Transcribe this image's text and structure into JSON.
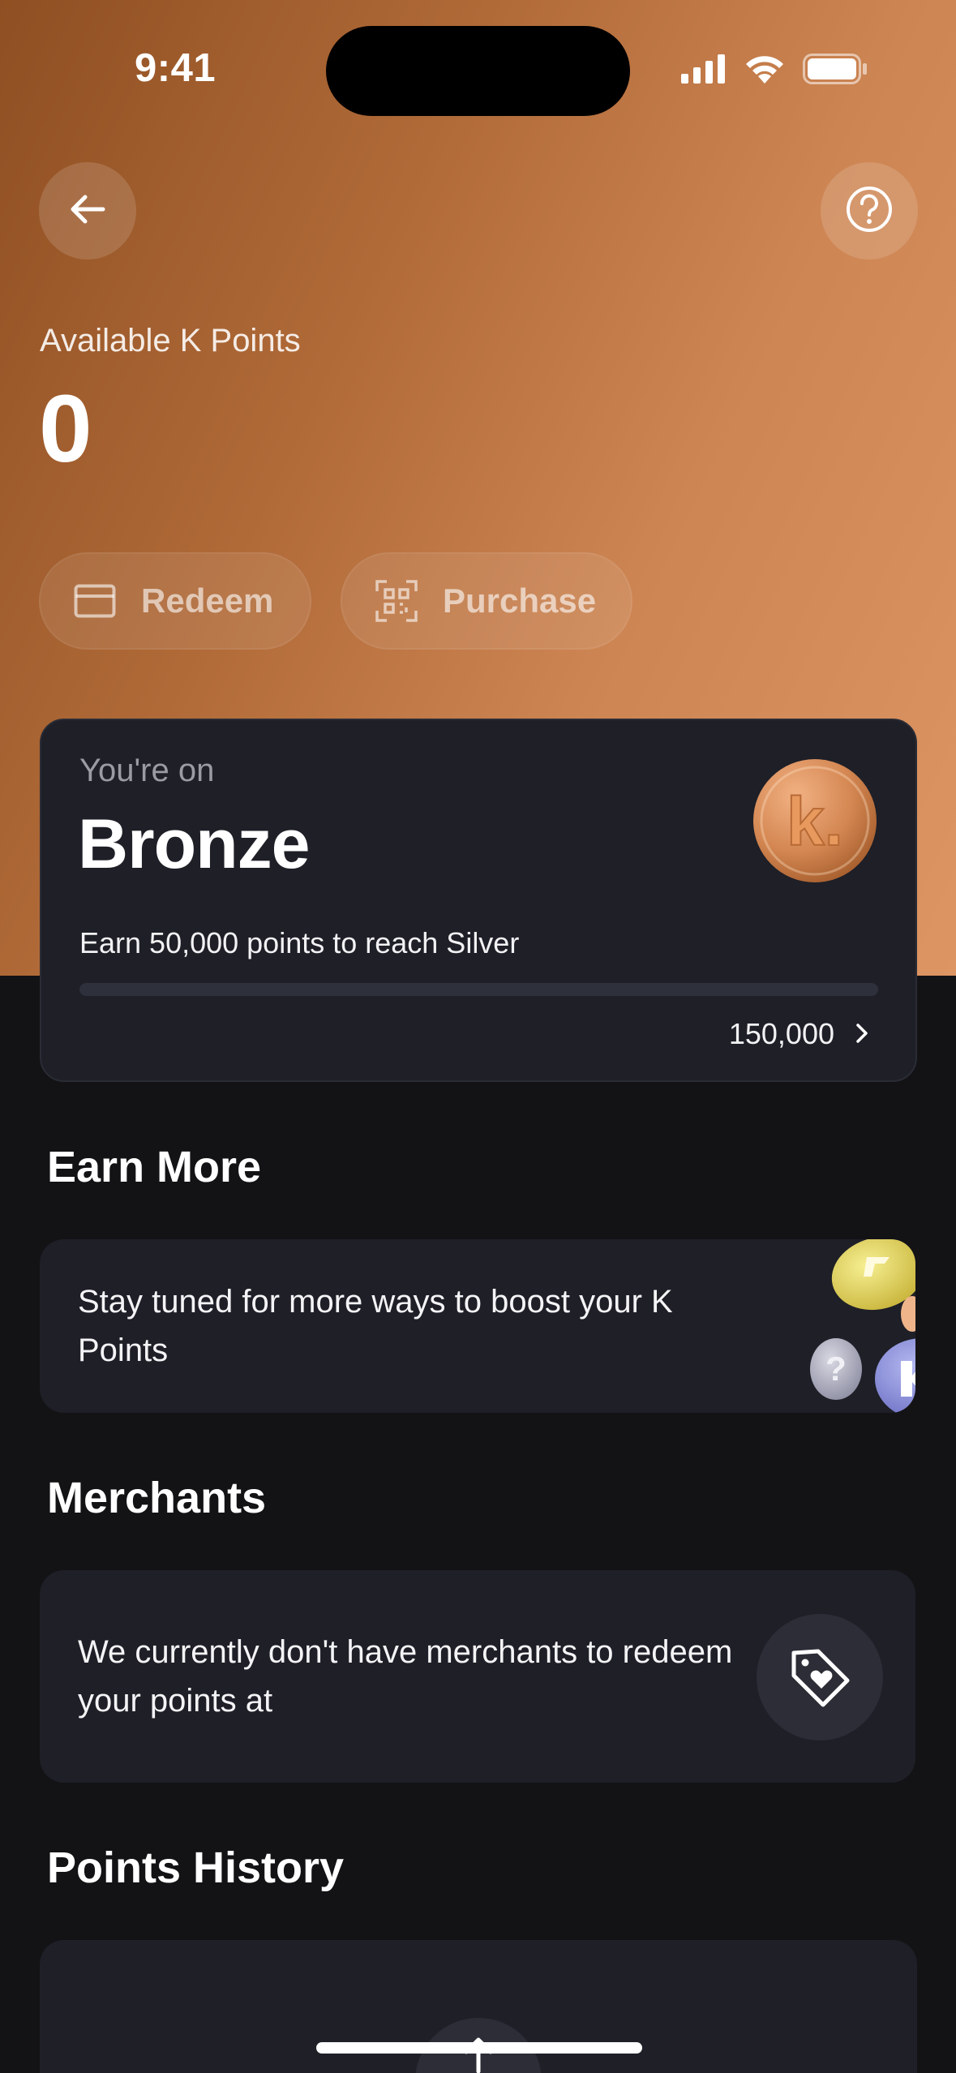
{
  "status_bar": {
    "time": "9:41"
  },
  "header": {
    "available_label": "Available K Points",
    "points": "0"
  },
  "actions": {
    "redeem_label": "Redeem",
    "purchase_label": "Purchase"
  },
  "tier": {
    "subtitle": "You're on",
    "name": "Bronze",
    "coin_letter": "k.",
    "earn_text": "Earn 50,000 points to reach Silver",
    "progress_fraction": 0,
    "target": "150,000"
  },
  "earn_more": {
    "title": "Earn More",
    "text": "Stay tuned for more ways to boost your K Points"
  },
  "merchants": {
    "title": "Merchants",
    "text": "We currently don't have merchants to redeem your points at"
  },
  "history": {
    "title": "Points History"
  },
  "colors": {
    "background": "#131316",
    "card": "#1e1f27",
    "hero_start": "#8f4f22",
    "hero_end": "#dd9563",
    "bronze": "#c77d49"
  },
  "icons": [
    "back-arrow-icon",
    "help-icon",
    "card-icon",
    "qr-scan-icon",
    "bronze-coin-icon",
    "chevron-right-icon",
    "coins-illustration",
    "tag-heart-icon",
    "arrow-up-icon",
    "signal-icon",
    "wifi-icon",
    "battery-icon"
  ]
}
